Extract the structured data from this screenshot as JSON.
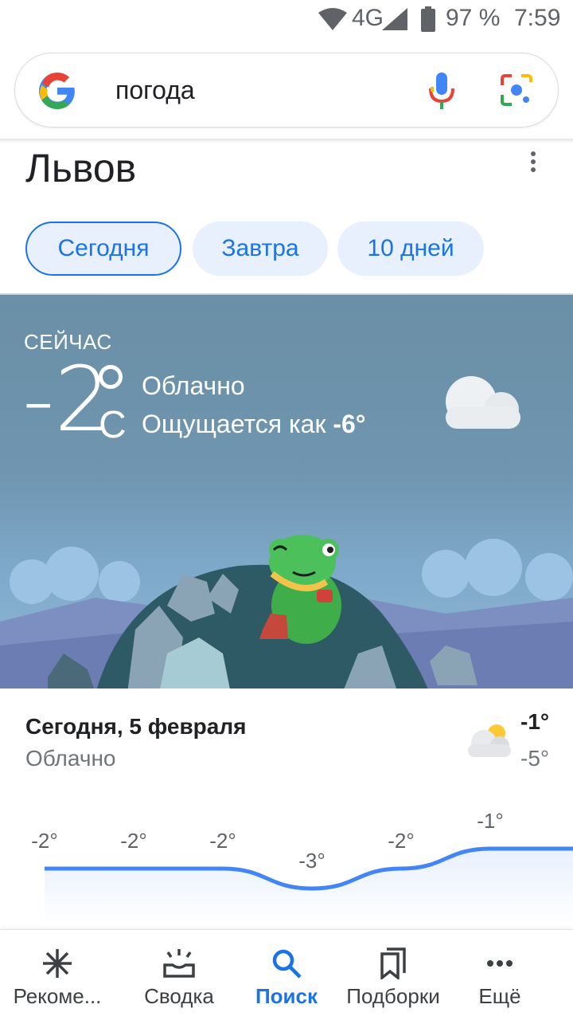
{
  "status_bar": {
    "network": "4G",
    "battery_percent": "97 %",
    "time": "7:59"
  },
  "search": {
    "query": "погода",
    "icons": [
      "google-logo-icon",
      "mic-icon",
      "lens-icon"
    ]
  },
  "location": {
    "city": "Львов"
  },
  "tabs": [
    {
      "label": "Сегодня",
      "active": true
    },
    {
      "label": "Завтра",
      "active": false
    },
    {
      "label": "10 дней",
      "active": false
    }
  ],
  "current": {
    "now_label": "СЕЙЧАС",
    "temperature": "-2",
    "unit": "C",
    "condition": "Облачно",
    "feels_like_prefix": "Ощущается как",
    "feels_like_value": "-6°",
    "icon": "cloud-icon"
  },
  "today": {
    "title": "Сегодня, 5 февраля",
    "condition": "Облачно",
    "high": "-1°",
    "low": "-5°",
    "icon": "partly-cloudy-icon"
  },
  "chart_data": {
    "type": "line",
    "title": "",
    "xlabel": "",
    "ylabel": "",
    "labels": [
      "-2°",
      "-2°",
      "-2°",
      "-3°",
      "-2°",
      "-1°",
      "-"
    ],
    "values": [
      -2,
      -2,
      -2,
      -3,
      -2,
      -1,
      -1
    ],
    "ylim": [
      -4,
      0
    ],
    "color": "#4285f4"
  },
  "bottom_nav": [
    {
      "label": "Рекоме...",
      "icon": "asterisk-icon",
      "active": false
    },
    {
      "label": "Сводка",
      "icon": "sunrise-icon",
      "active": false
    },
    {
      "label": "Поиск",
      "icon": "search-icon",
      "active": true
    },
    {
      "label": "Подборки",
      "icon": "bookmark-icon",
      "active": false
    },
    {
      "label": "Ещё",
      "icon": "more-horizontal-icon",
      "active": false
    }
  ],
  "colors": {
    "accent": "#1a73e8",
    "chip_bg": "#e8f0fe",
    "hero_sky": "#6f95b0"
  }
}
